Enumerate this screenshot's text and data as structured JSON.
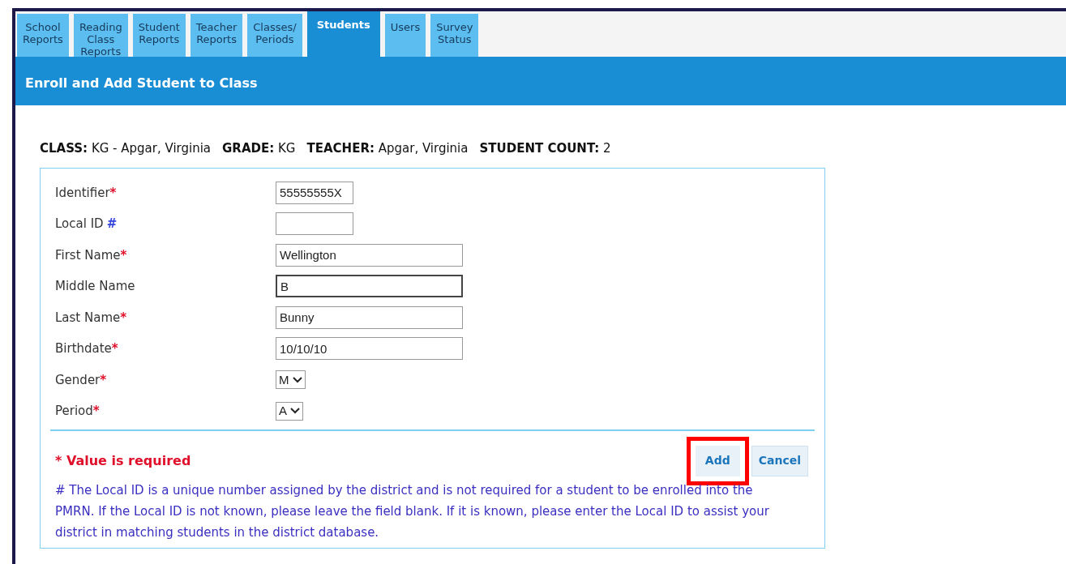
{
  "tabs": [
    {
      "label": "School Reports",
      "selected": false
    },
    {
      "label": "Reading Class Reports",
      "selected": false
    },
    {
      "label": "Student Reports",
      "selected": false
    },
    {
      "label": "Teacher Reports",
      "selected": false
    },
    {
      "label": "Classes/ Periods",
      "selected": false
    },
    {
      "label": "Students",
      "selected": true
    },
    {
      "label": "Users",
      "selected": false
    },
    {
      "label": "Survey Status",
      "selected": false
    }
  ],
  "header": {
    "title": "Enroll and Add Student to Class"
  },
  "class_info": [
    {
      "label": "CLASS:",
      "value": "KG - Apgar, Virginia"
    },
    {
      "label": "GRADE:",
      "value": "KG"
    },
    {
      "label": "TEACHER:",
      "value": "Apgar, Virginia"
    },
    {
      "label": "STUDENT COUNT:",
      "value": "2"
    }
  ],
  "fields": [
    {
      "kind": "short",
      "label": "Identifier",
      "marker": {
        "text": "*",
        "color": "#e0102a"
      },
      "value": "55555555X",
      "focused": false
    },
    {
      "kind": "short",
      "label": "Local ID",
      "marker": {
        "text": "#",
        "color": "#3344dd"
      },
      "focused": false
    },
    {
      "kind": "text",
      "label": "First Name",
      "marker": {
        "text": "*",
        "color": "#e0102a"
      },
      "value": "Wellington",
      "focused": false
    },
    {
      "kind": "text",
      "label": "Middle Name",
      "value": "B",
      "focused": true
    },
    {
      "kind": "text",
      "label": "Last Name",
      "marker": {
        "text": "*",
        "color": "#e0102a"
      },
      "value": "Bunny",
      "focused": false
    },
    {
      "kind": "text",
      "label": "Birthdate",
      "marker": {
        "text": "*",
        "color": "#e0102a"
      },
      "value": "10/10/10",
      "focused": false
    },
    {
      "kind": "select",
      "label": "Gender",
      "marker": {
        "text": "*",
        "color": "#e0102a"
      },
      "value": "M",
      "focused": false
    },
    {
      "kind": "select",
      "label": "Period",
      "marker": {
        "text": "*",
        "color": "#e0102a"
      },
      "value": "A",
      "focused": false
    }
  ],
  "required_note": "* Value is required",
  "buttons": [
    {
      "label": "Add",
      "highlighted": true
    },
    {
      "label": "Cancel",
      "highlighted": false
    }
  ],
  "footnote": "# The Local ID is a unique number assigned by the district and is not required for a student to be enrolled into the PMRN. If the Local ID is not known, please leave the field blank. If it is known, please enter the Local ID to assist your district in matching students in the district database."
}
